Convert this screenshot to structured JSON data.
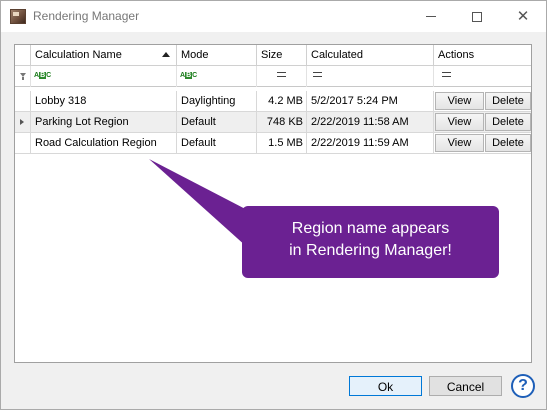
{
  "window": {
    "title": "Rendering Manager"
  },
  "table": {
    "columns": {
      "name": "Calculation Name",
      "mode": "Mode",
      "size": "Size",
      "calculated": "Calculated",
      "actions": "Actions"
    },
    "rows": [
      {
        "name": "Lobby 318",
        "mode": "Daylighting",
        "size": "4.2 MB",
        "calculated": "5/2/2017 5:24 PM",
        "view": "View",
        "delete": "Delete",
        "selected": false
      },
      {
        "name": "Parking Lot Region",
        "mode": "Default",
        "size": "748 KB",
        "calculated": "2/22/2019 11:58 AM",
        "view": "View",
        "delete": "Delete",
        "selected": true
      },
      {
        "name": "Road Calculation Region",
        "mode": "Default",
        "size": "1.5 MB",
        "calculated": "2/22/2019 11:59 AM",
        "view": "View",
        "delete": "Delete",
        "selected": false
      }
    ]
  },
  "callout": {
    "line1": "Region name appears",
    "line2": "in Rendering Manager!",
    "color": "#6b2192"
  },
  "footer": {
    "ok_label": "Ok",
    "cancel_label": "Cancel",
    "help_label": "?"
  },
  "icons": {
    "app": "rendering-manager-icon",
    "filter_row": "funnel-icon",
    "text_filter": "abc-filter-icon",
    "equals_filter": "equals-filter-icon",
    "sort": "sort-ascending-icon",
    "current_row": "row-indicator-icon"
  }
}
